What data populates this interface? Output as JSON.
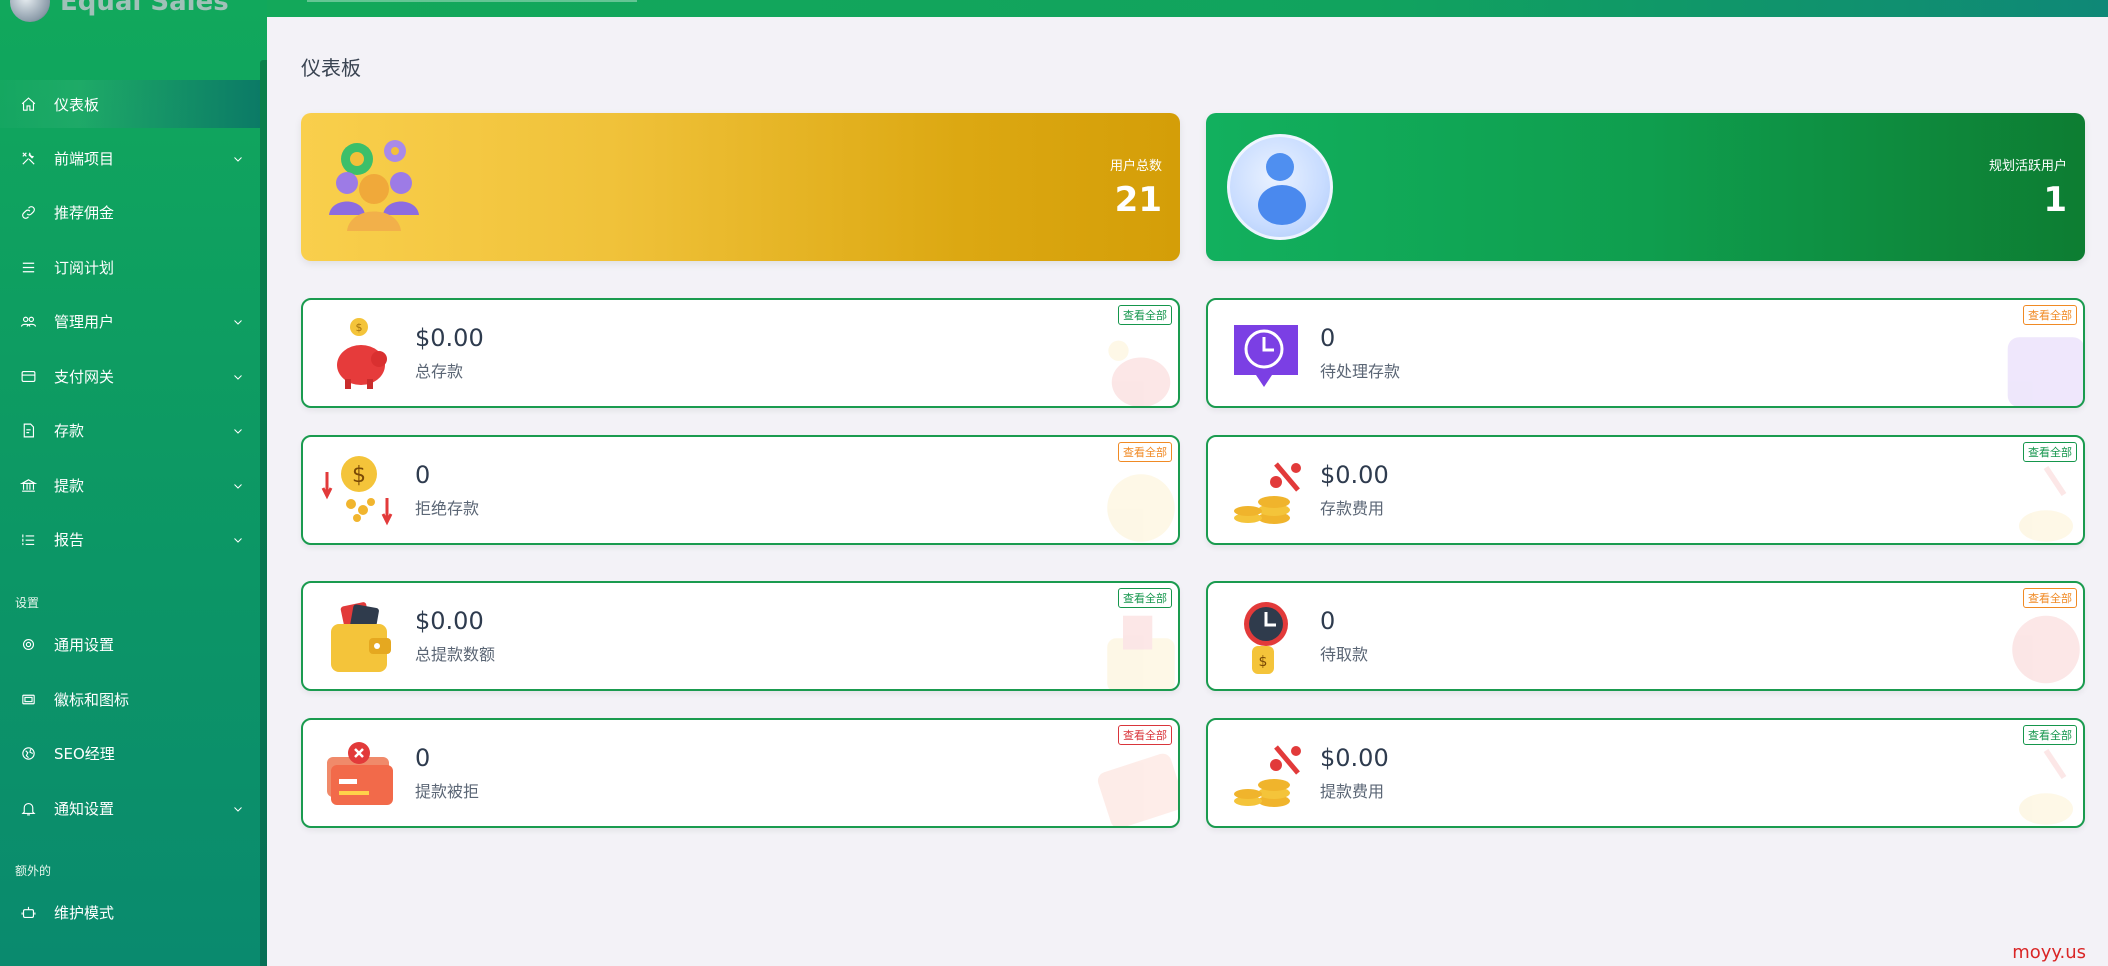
{
  "app": {
    "name": "Equal Sales"
  },
  "sidebar": {
    "items": [
      {
        "label": "仪表板",
        "icon": "home-icon",
        "active": true,
        "has_submenu": false
      },
      {
        "label": "前端项目",
        "icon": "tools-icon",
        "active": false,
        "has_submenu": true
      },
      {
        "label": "推荐佣金",
        "icon": "link-icon",
        "active": false,
        "has_submenu": false
      },
      {
        "label": "订阅计划",
        "icon": "menu-icon",
        "active": false,
        "has_submenu": false
      },
      {
        "label": "管理用户",
        "icon": "users-icon",
        "active": false,
        "has_submenu": true
      },
      {
        "label": "支付网关",
        "icon": "card-icon",
        "active": false,
        "has_submenu": true
      },
      {
        "label": "存款",
        "icon": "deposit-icon",
        "active": false,
        "has_submenu": true
      },
      {
        "label": "提款",
        "icon": "bank-icon",
        "active": false,
        "has_submenu": true
      },
      {
        "label": "报告",
        "icon": "list-icon",
        "active": false,
        "has_submenu": true
      }
    ],
    "section_settings": "设置",
    "settings_items": [
      {
        "label": "通用设置",
        "icon": "settings-icon",
        "has_submenu": false
      },
      {
        "label": "徽标和图标",
        "icon": "image-icon",
        "has_submenu": false
      },
      {
        "label": "SEO经理",
        "icon": "globe-icon",
        "has_submenu": false
      },
      {
        "label": "通知设置",
        "icon": "bell-icon",
        "has_submenu": true
      }
    ],
    "section_extra": "额外的",
    "extra_items": [
      {
        "label": "维护模式",
        "icon": "robot-icon",
        "has_submenu": false
      }
    ]
  },
  "main": {
    "title": "仪表板",
    "stat_cards": [
      {
        "label": "用户总数",
        "value": "21"
      },
      {
        "label": "规划活跃用户",
        "value": "1"
      }
    ],
    "info_cards": [
      {
        "value": "$0.00",
        "label": "总存款",
        "badge": "查看全部",
        "badge_color": "#15964c",
        "icon": "piggy-bank-icon"
      },
      {
        "value": "0",
        "label": "待处理存款",
        "badge": "查看全部",
        "badge_color": "#f08a24",
        "icon": "clock-icon"
      },
      {
        "value": "0",
        "label": "拒绝存款",
        "badge": "查看全部",
        "badge_color": "#f08a24",
        "icon": "coins-down-icon"
      },
      {
        "value": "$0.00",
        "label": "存款费用",
        "badge": "查看全部",
        "badge_color": "#15964c",
        "icon": "coins-percent-icon"
      },
      {
        "value": "$0.00",
        "label": "总提款数额",
        "badge": "查看全部",
        "badge_color": "#15964c",
        "icon": "wallet-icon"
      },
      {
        "value": "0",
        "label": "待取款",
        "badge": "查看全部",
        "badge_color": "#f08a24",
        "icon": "clock-money-icon"
      },
      {
        "value": "0",
        "label": "提款被拒",
        "badge": "查看全部",
        "badge_color": "#d9353b",
        "icon": "card-rejected-icon"
      },
      {
        "value": "$0.00",
        "label": "提款费用",
        "badge": "查看全部",
        "badge_color": "#15964c",
        "icon": "coins-percent-icon"
      }
    ]
  },
  "watermark": "moyy.us"
}
